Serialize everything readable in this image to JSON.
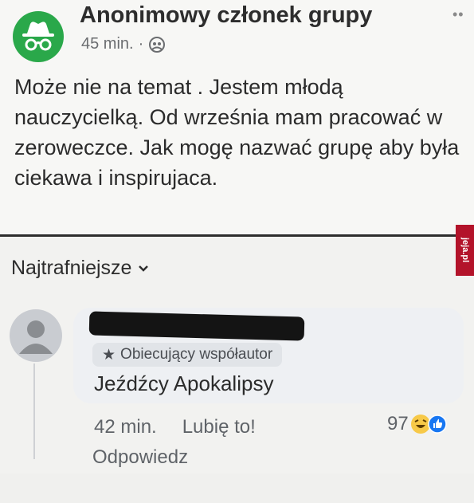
{
  "post": {
    "author": "Anonimowy członek grupy",
    "time": "45 min.",
    "separator": "·",
    "menu": "••",
    "text": "Może nie na temat . Jestem młodą nauczycielką. Od września mam pracować w zeroweczce. Jak mogę nazwać grupę aby była ciekawa i inspirujaca.",
    "avatar_color": "#2aa84a"
  },
  "watermark": {
    "text": "jeja.pl",
    "color": "#b3132a"
  },
  "comments_section": {
    "sort_label": "Najtrafniejsze"
  },
  "comment": {
    "badge": "Obiecujący współautor",
    "text": "Jeźdźcy Apokalipsy",
    "time": "42 min.",
    "like_label": "Lubię to!",
    "reply_label": "Odpowiedz",
    "reaction_count": "97"
  }
}
